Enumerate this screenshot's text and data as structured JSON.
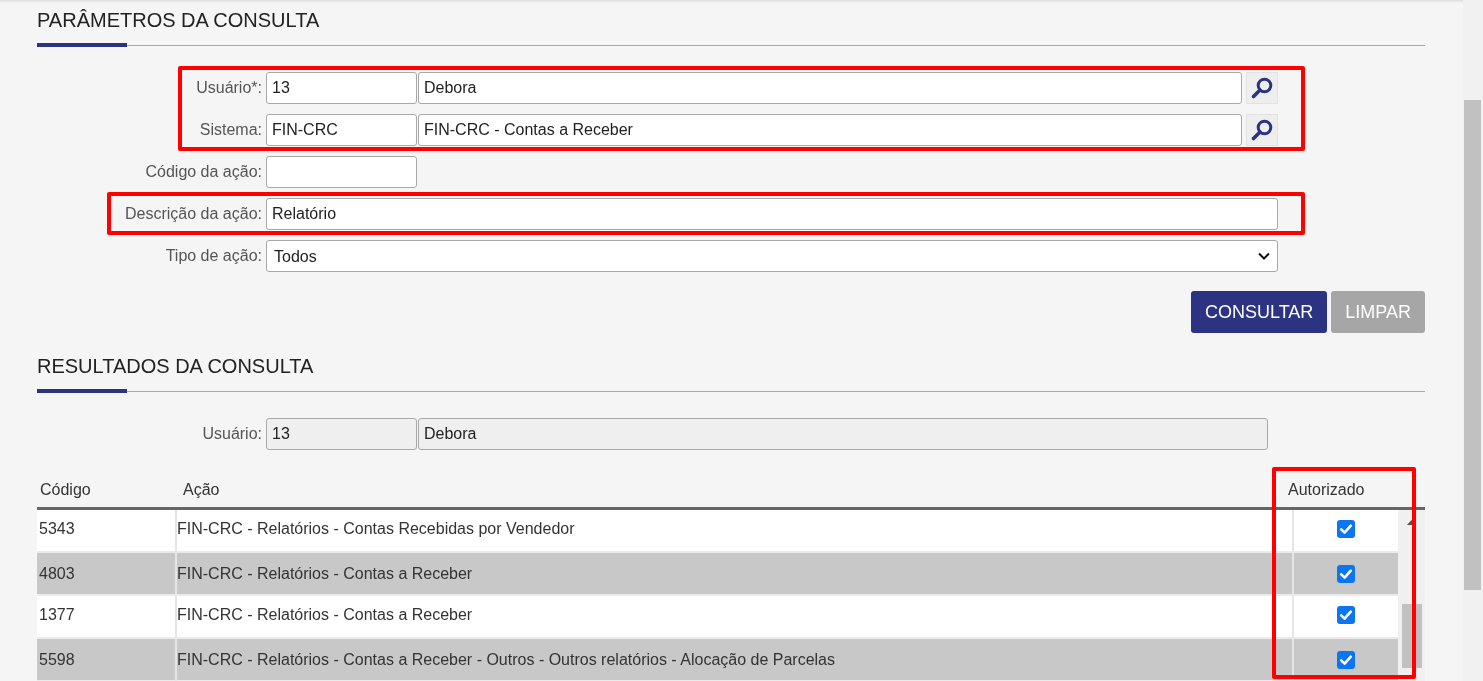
{
  "parameters": {
    "title": "PARÂMETROS DA CONSULTA",
    "fields": [
      {
        "kind": "lookup",
        "label": "Usuário*:",
        "code": "13",
        "description": "Debora",
        "highlighted": true
      },
      {
        "kind": "lookup",
        "label": "Sistema:",
        "code": "FIN-CRC",
        "description": "FIN-CRC - Contas a Receber",
        "highlighted": true
      },
      {
        "kind": "short",
        "label": "Código da ação:",
        "highlighted": false
      },
      {
        "kind": "text",
        "label": "Descrição da ação:",
        "value": "Relatório",
        "highlighted": true
      },
      {
        "kind": "select",
        "label": "Tipo de ação:",
        "value": "Todos",
        "highlighted": false
      }
    ],
    "buttons": [
      {
        "label": "CONSULTAR",
        "kind": "primary"
      },
      {
        "label": "LIMPAR",
        "kind": "secondary"
      }
    ]
  },
  "results": {
    "title": "RESULTADOS DA CONSULTA",
    "user": {
      "label": "Usuário:",
      "code": "13",
      "name": "Debora",
      "readonly": true
    },
    "table": {
      "columns": [
        {
          "label": "Código",
          "highlighted": false
        },
        {
          "label": "Ação",
          "highlighted": false
        },
        {
          "label": "Autorizado",
          "highlighted": true
        }
      ],
      "rows": [
        {
          "code": "5343",
          "action": "FIN-CRC - Relatórios - Contas Recebidas por Vendedor",
          "authorized": true
        },
        {
          "code": "4803",
          "action": "FIN-CRC - Relatórios - Contas a Receber",
          "authorized": true
        },
        {
          "code": "1377",
          "action": "FIN-CRC - Relatórios - Contas a Receber",
          "authorized": true
        },
        {
          "code": "5598",
          "action": "FIN-CRC - Relatórios - Contas a Receber - Outros - Outros relatórios - Alocação de Parcelas",
          "authorized": true
        }
      ]
    }
  }
}
